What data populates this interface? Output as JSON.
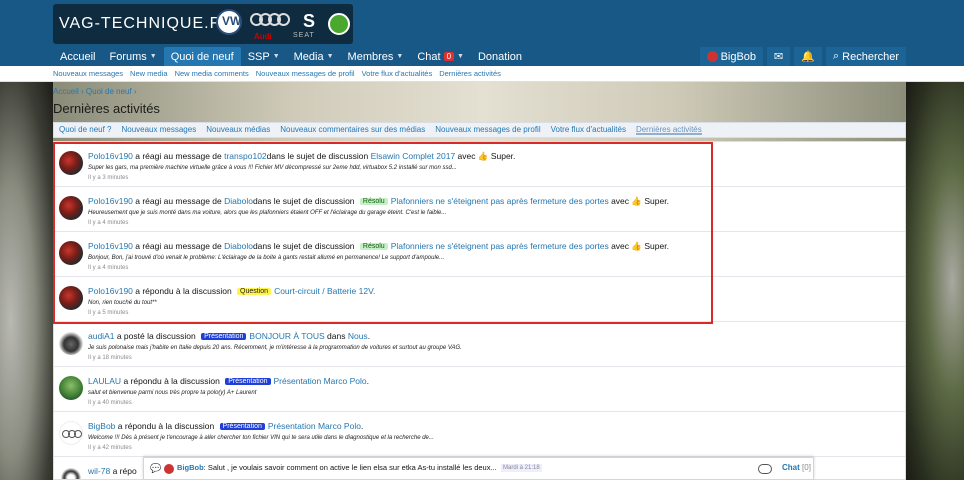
{
  "site": {
    "logo_text": "VAG-TECHNIQUE.FR",
    "vw_mark": "VW",
    "audi_label": "Audi",
    "seat_mark": "S",
    "seat_label": "SEAT"
  },
  "nav": {
    "items": [
      {
        "label": "Accueil",
        "caret": false
      },
      {
        "label": "Forums",
        "caret": true
      },
      {
        "label": "Quoi de neuf",
        "caret": false,
        "active": true
      },
      {
        "label": "SSP",
        "caret": true
      },
      {
        "label": "Media",
        "caret": true
      },
      {
        "label": "Membres",
        "caret": true
      },
      {
        "label": "Chat",
        "caret": true,
        "badge": "0"
      },
      {
        "label": "Donation",
        "caret": false
      }
    ],
    "user": "BigBob",
    "search": "Rechercher"
  },
  "subnav": [
    "Nouveaux messages",
    "New media",
    "New media comments",
    "Nouveaux messages de profil",
    "Votre flux d'actualités",
    "Dernières activités"
  ],
  "breadcrumb": "Accueil  ›  Quoi de neuf  ›",
  "page_title": "Dernières activités",
  "tabs": [
    {
      "label": "Quoi de neuf ?"
    },
    {
      "label": "Nouveaux messages"
    },
    {
      "label": "Nouveaux médias"
    },
    {
      "label": "Nouveaux commentaires sur des médias"
    },
    {
      "label": "Nouveaux messages de profil"
    },
    {
      "label": "Votre flux d'actualités"
    },
    {
      "label": "Dernières activités",
      "active": true
    }
  ],
  "feed": [
    {
      "user": "Polo16v190",
      "action": " a réagi au message de ",
      "target": "transpo102",
      "mid": "dans le sujet de discussion ",
      "tag": "",
      "thread": "Elsawin Complet 2017",
      "tail": " avec ",
      "reaction": "👍",
      "reaction_label": " Super.",
      "snippet": "Super les gars, ma première machine virtuelle grâce à vous !!! Fichier MV décompressé sur 2eme hdd, virtuabox 5.2 installé sur mon ssd...",
      "time": "Il y a 3 minutes"
    },
    {
      "user": "Polo16v190",
      "action": " a réagi au message de ",
      "target": "Diabolo",
      "mid": "dans le sujet de discussion ",
      "tag": "Résolu",
      "thread": "Plafonniers ne s'éteignent pas après fermeture des portes",
      "tail": " avec ",
      "reaction": "👍",
      "reaction_label": " Super.",
      "snippet": "Heureusement que je suis monté dans ma voiture, alors que les plafonniers étaient OFF et l'éclairage du garage éteint. C'est le faible...",
      "time": "Il y a 4 minutes"
    },
    {
      "user": "Polo16v190",
      "action": " a réagi au message de ",
      "target": "Diabolo",
      "mid": "dans le sujet de discussion ",
      "tag": "Résolu",
      "thread": "Plafonniers ne s'éteignent pas après fermeture des portes",
      "tail": " avec ",
      "reaction": "👍",
      "reaction_label": " Super.",
      "snippet": "Bonjour, Bon, j'ai trouvé d'où venait le problème: L'éclairage de la boite à gants restait allumé en permanence! Le support d'ampoule...",
      "time": "Il y a 4 minutes"
    },
    {
      "user": "Polo16v190",
      "action": " a répondu à la discussion ",
      "target": "",
      "mid": "",
      "tag": "Question",
      "thread": "Court-circuit / Batterie 12V.",
      "tail": "",
      "reaction": "",
      "reaction_label": "",
      "snippet": "Non, rien touché du tout**",
      "time": "Il y a 5 minutes"
    },
    {
      "user": "audiA1",
      "action": " a posté la discussion ",
      "target": "",
      "mid": "",
      "tag": "Présentation",
      "thread": "BONJOUR À TOUS",
      "tail": " dans ",
      "reaction": "",
      "reaction_label": "",
      "forum": "Nous",
      "end": ".",
      "snippet": "Je suis polonaise mais j'habite en Italie depuis 20 ans. Récemment, je m'intéresse à la programmation de voitures et surtout au groupe VAG.",
      "time": "Il y a 18 minutes"
    },
    {
      "user": "LAULAU",
      "action": " a répondu à la discussion ",
      "target": "",
      "mid": "",
      "tag": "Présentation",
      "thread": "Présentation Marco Polo",
      "tail": ".",
      "reaction": "",
      "reaction_label": "",
      "snippet": "salut et bienvenue parmi nous très propre ta polo(y) A+ Laurent",
      "time": "Il y a 40 minutes"
    },
    {
      "user": "BigBob",
      "action": " a répondu à la discussion ",
      "target": "",
      "mid": "",
      "tag": "Présentation",
      "thread": "Présentation Marco Polo",
      "tail": ".",
      "reaction": "",
      "reaction_label": "",
      "snippet": "Welcome !!! Dès à présent je t'encourage à aller chercher ton fichier VIN qui te sera utile dans le diagnostique et la recherche de...",
      "time": "Il y a 42 minutes"
    },
    {
      "user": "wil-78",
      "action": " a répo",
      "target": "",
      "mid": "",
      "tag": "",
      "thread": "",
      "tail": "",
      "reaction": "",
      "reaction_label": "",
      "snippet": "",
      "time": ""
    }
  ],
  "chat": {
    "user": "BigBob",
    "message": ": Salut , je voulais savoir comment on active le lien elsa sur etka As-tu installé les deux...",
    "time": "Mardi à 21:18",
    "label": "Chat",
    "count": "[0]"
  }
}
